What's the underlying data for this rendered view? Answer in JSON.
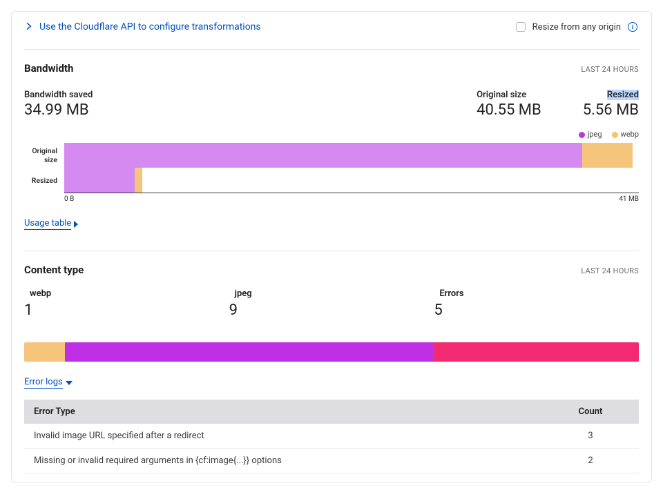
{
  "top": {
    "config_link": "Use the Cloudflare API to configure transformations",
    "resize_label": "Resize from any origin"
  },
  "bandwidth": {
    "title": "Bandwidth",
    "period": "LAST 24 HOURS",
    "stats": {
      "saved_label": "Bandwidth saved",
      "saved_value": "34.99 MB",
      "orig_label": "Original size",
      "orig_value": "40.55 MB",
      "resized_label": "Resized",
      "resized_value": "5.56 MB"
    },
    "legend": {
      "jpeg": "jpeg",
      "webp": "webp"
    },
    "axis": {
      "rowA": "Original size",
      "rowB": "Resized",
      "min": "0 B",
      "max": "41 MB"
    },
    "usage_link": "Usage table"
  },
  "chart_data": {
    "type": "bar",
    "orientation": "horizontal",
    "units": "MB",
    "xlim": [
      0,
      41
    ],
    "categories": [
      "Original size",
      "Resized"
    ],
    "series": [
      {
        "name": "jpeg",
        "color": "#c869f0",
        "values": [
          37.0,
          5.0
        ]
      },
      {
        "name": "webp",
        "color": "#f6c57c",
        "values": [
          3.55,
          0.56
        ]
      }
    ]
  },
  "content_type": {
    "title": "Content type",
    "period": "LAST 24 HOURS",
    "items": [
      {
        "name": "webp",
        "value": "1",
        "color": "#f6c57c"
      },
      {
        "name": "jpeg",
        "value": "9",
        "color": "#bf2fe5"
      },
      {
        "name": "Errors",
        "value": "5",
        "color": "#f32971"
      }
    ],
    "error_logs_link": "Error logs",
    "table": {
      "headers": {
        "type": "Error Type",
        "count": "Count"
      },
      "rows": [
        {
          "type": "Invalid image URL specified after a redirect",
          "count": "3"
        },
        {
          "type": "Missing or invalid required arguments in {cf:image{...}} options",
          "count": "2"
        }
      ]
    }
  }
}
